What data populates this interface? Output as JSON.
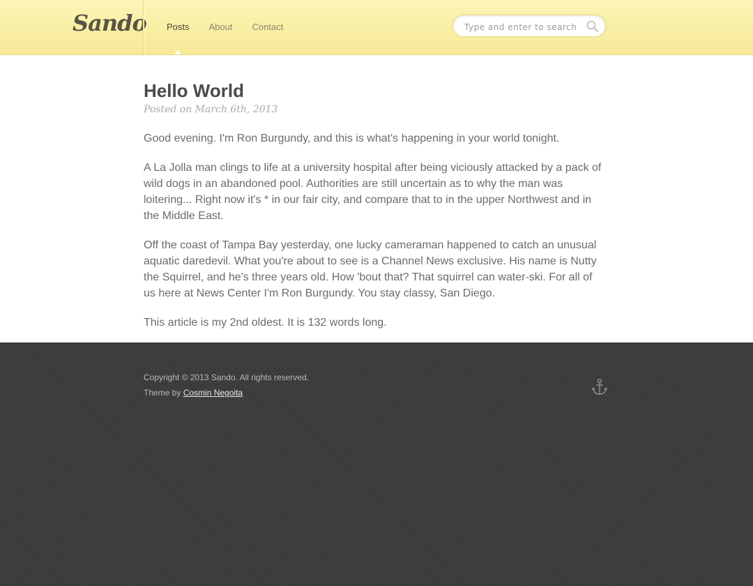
{
  "header": {
    "logo": "Sando",
    "nav": [
      {
        "label": "Posts",
        "active": true
      },
      {
        "label": "About",
        "active": false
      },
      {
        "label": "Contact",
        "active": false
      }
    ],
    "search": {
      "placeholder": "Type and enter to search",
      "value": "",
      "icon": "search-icon"
    }
  },
  "post": {
    "title": "Hello World",
    "date": "Posted on March 6th, 2013",
    "paragraphs": [
      "Good evening. I'm Ron Burgundy, and this is what's happening in your world tonight.",
      "A La Jolla man clings to life at a university hospital after being viciously attacked by a pack of wild dogs in an abandoned pool. Authorities are still uncertain as to why the man was loitering... Right now it's * in our fair city, and compare that to in the upper Northwest and in the Middle East.",
      "Off the coast of Tampa Bay yesterday, one lucky cameraman happened to catch an unusual aquatic daredevil. What you're about to see is a Channel News exclusive. His name is Nutty the Squirrel, and he's three years old. How 'bout that? That squirrel can water-ski. For all of us here at News Center I'm Ron Burgundy. You stay classy, San Diego.",
      "This article is my 2nd oldest. It is 132 words long."
    ]
  },
  "footer": {
    "copyright": "Copyright © 2013 Sando. All rights reserved.",
    "theme_prefix": "Theme by",
    "theme_author": "Cosmin Negoita",
    "icon": "anchor-icon"
  },
  "colors": {
    "header_bg": "#f6ea98",
    "footer_bg": "#3c3c3c",
    "text": "#6b6b6b"
  }
}
